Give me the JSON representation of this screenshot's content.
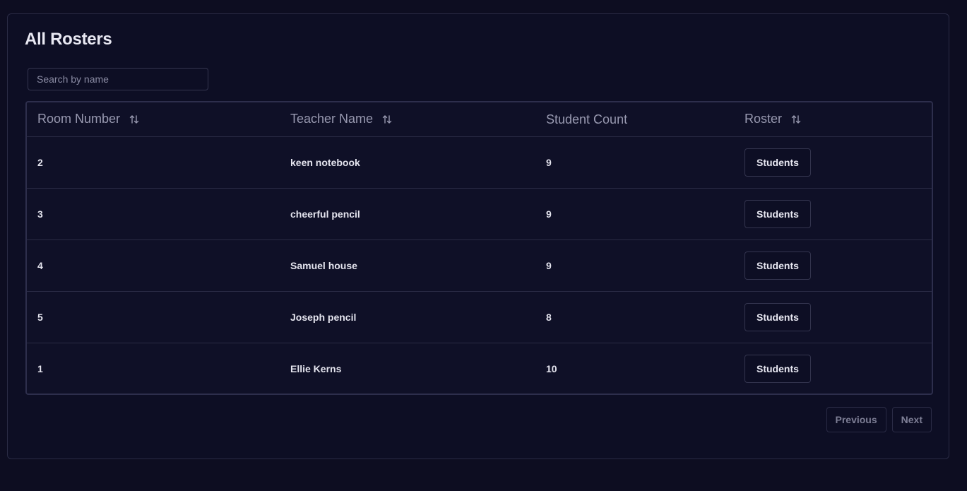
{
  "page": {
    "title": "All Rosters"
  },
  "search": {
    "placeholder": "Search by name",
    "value": ""
  },
  "table": {
    "columns": [
      {
        "label": "Room Number",
        "sortable": true
      },
      {
        "label": "Teacher Name",
        "sortable": true
      },
      {
        "label": "Student Count",
        "sortable": false
      },
      {
        "label": "Roster",
        "sortable": true
      }
    ],
    "rows": [
      {
        "room": "2",
        "teacher": "keen notebook",
        "count": "9",
        "action": "Students"
      },
      {
        "room": "3",
        "teacher": "cheerful pencil",
        "count": "9",
        "action": "Students"
      },
      {
        "room": "4",
        "teacher": "Samuel house",
        "count": "9",
        "action": "Students"
      },
      {
        "room": "5",
        "teacher": "Joseph pencil",
        "count": "8",
        "action": "Students"
      },
      {
        "room": "1",
        "teacher": "Ellie Kerns",
        "count": "10",
        "action": "Students"
      }
    ]
  },
  "pagination": {
    "previous_label": "Previous",
    "next_label": "Next"
  },
  "icons": {
    "sort": "sort-arrows-icon"
  },
  "colors": {
    "background": "#0d0d21",
    "border": "#2a2b45",
    "text": "#e6e6f0",
    "muted": "#9899b0"
  }
}
